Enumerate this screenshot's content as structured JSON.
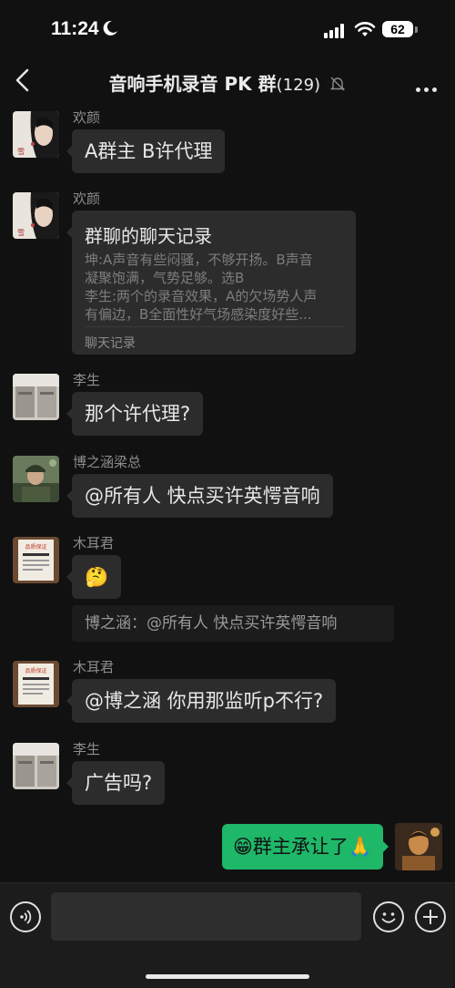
{
  "status": {
    "time": "11:24",
    "battery": "62"
  },
  "header": {
    "title": "音响手机录音 PK 群",
    "member_count": "(129)"
  },
  "messages": [
    {
      "sender": "欢颜",
      "text": "A群主 B许代理"
    },
    {
      "sender": "欢颜",
      "card": {
        "title": "群聊的聊天记录",
        "lines": [
          "坤:A声音有些闷骚，不够开扬。B声音",
          "凝聚饱满，气势足够。选B",
          "李生:两个的录音效果，A的欠场势人声",
          "有偏边，B全面性好气场感染度好些..."
        ],
        "footer": "聊天记录"
      }
    },
    {
      "sender": "李生",
      "text": "那个许代理?"
    },
    {
      "sender": "博之涵梁总",
      "text": "@所有人 快点买许英愕音响"
    },
    {
      "sender": "木耳君",
      "text": "🤔"
    },
    {
      "quote": "博之涵：@所有人 快点买许英愕音响"
    },
    {
      "sender": "木耳君",
      "text": "@博之涵 你用那监听p不行?"
    },
    {
      "sender": "李生",
      "text": "广告吗?"
    },
    {
      "self": true,
      "text": "😁群主承让了🙏"
    }
  ],
  "avatars": {
    "seal_text": "品质保证"
  },
  "input": {
    "placeholder": ""
  },
  "colors": {
    "background": "#111111",
    "bubble": "#2c2c2c",
    "self_bubble": "#1fb768"
  }
}
